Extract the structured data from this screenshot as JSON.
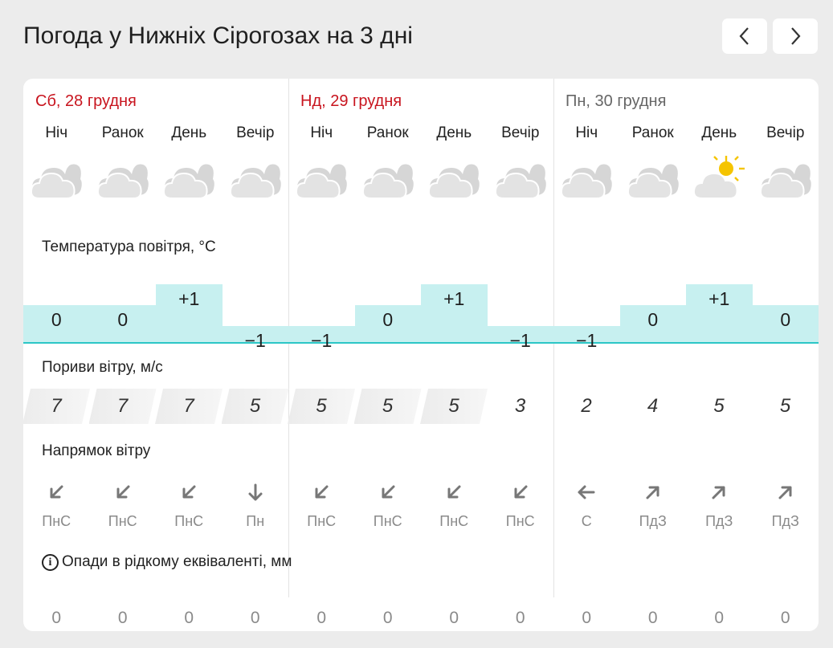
{
  "title": "Погода у Нижніх Сірогозах на 3 дні",
  "colors": {
    "weekend": "#c8141e",
    "weekday": "#666666",
    "temp_fill": "#c7f0f0",
    "temp_line": "#2cc6c6",
    "sun": "#f5c400"
  },
  "days": [
    {
      "label": "Сб, 28 грудня",
      "weekend": true
    },
    {
      "label": "Нд, 29 грудня",
      "weekend": true
    },
    {
      "label": "Пн, 30 грудня",
      "weekend": false
    }
  ],
  "periods": [
    "Ніч",
    "Ранок",
    "День",
    "Вечір",
    "Ніч",
    "Ранок",
    "День",
    "Вечір",
    "Ніч",
    "Ранок",
    "День",
    "Вечір"
  ],
  "icons": [
    "cloudy-icon",
    "cloudy-icon",
    "cloudy-icon",
    "cloudy-icon",
    "cloudy-icon",
    "cloudy-icon",
    "cloudy-icon",
    "cloudy-icon",
    "cloudy-icon",
    "cloudy-icon",
    "partly-sunny-icon",
    "cloudy-icon"
  ],
  "temperature": {
    "label": "Температура повітря, °C",
    "values": [
      0,
      0,
      1,
      -1,
      -1,
      0,
      1,
      -1,
      -1,
      0,
      1,
      0
    ],
    "display": [
      "0",
      "0",
      "+1",
      "−1",
      "−1",
      "0",
      "+1",
      "−1",
      "−1",
      "0",
      "+1",
      "0"
    ]
  },
  "gusts": {
    "label": "Пориви вітру, м/с",
    "values": [
      "7",
      "7",
      "7",
      "5",
      "5",
      "5",
      "5",
      "3",
      "2",
      "4",
      "5",
      "5"
    ],
    "shaded": [
      true,
      true,
      true,
      true,
      true,
      true,
      true,
      false,
      false,
      false,
      false,
      false
    ]
  },
  "wind_direction": {
    "label": "Напрямок вітру",
    "arrows": [
      "arrow-down-left-icon",
      "arrow-down-left-icon",
      "arrow-down-left-icon",
      "arrow-down-icon",
      "arrow-down-left-icon",
      "arrow-down-left-icon",
      "arrow-down-left-icon",
      "arrow-down-left-icon",
      "arrow-left-icon",
      "arrow-up-right-icon",
      "arrow-up-right-icon",
      "arrow-up-right-icon"
    ],
    "codes": [
      "ПнС",
      "ПнС",
      "ПнС",
      "Пн",
      "ПнС",
      "ПнС",
      "ПнС",
      "ПнС",
      "С",
      "ПдЗ",
      "ПдЗ",
      "ПдЗ"
    ]
  },
  "precipitation": {
    "label": "Опади в рідкому еквіваленті, мм",
    "values": [
      "0",
      "0",
      "0",
      "0",
      "0",
      "0",
      "0",
      "0",
      "0",
      "0",
      "0",
      "0"
    ]
  }
}
